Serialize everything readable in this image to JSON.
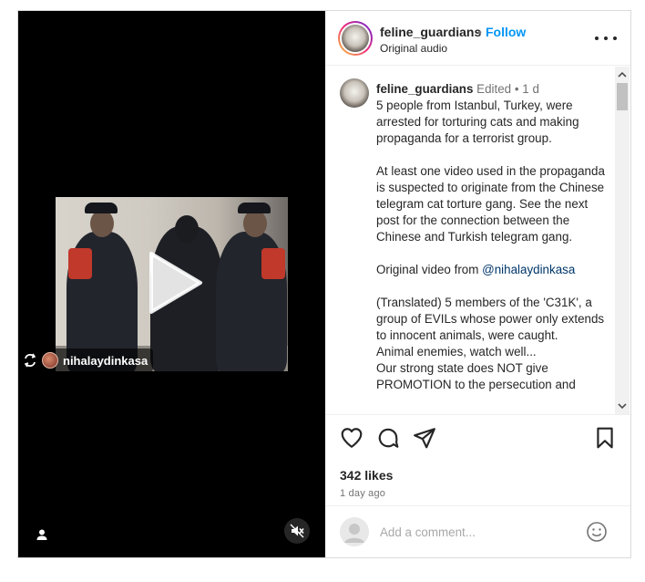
{
  "post": {
    "media": {
      "tag_username": "nihalaydinkasa",
      "icons": {
        "play": "play-icon",
        "tag_reel": "reel-share-icon",
        "user_tags": "user-tag-icon",
        "mute": "mute-icon"
      }
    },
    "header": {
      "username": "feline_guardians",
      "separator": "•",
      "follow_label": "Follow",
      "audio": "Original audio",
      "more_icon": "more-horizontal-icon"
    },
    "caption": {
      "username": "feline_guardians",
      "edited": "Edited",
      "separator": "•",
      "age": "1 d",
      "body_part1": "5 people from Istanbul, Turkey, were arrested for torturing cats and making propaganda for a terrorist group.\n\nAt least one video used in the propaganda is suspected to originate from the Chinese telegram cat torture gang. See the next post for the connection between the Chinese and Turkish telegram gang.\n\nOriginal video from ",
      "mention": "@nihalaydinkasa",
      "body_part2": "\n\n(Translated) 5 members of the 'C31K', a group of EVILs whose power only extends to innocent animals, were caught.\nAnimal enemies, watch well...\nOur strong state does NOT give PROMOTION to the persecution and"
    },
    "actions": {
      "like_icon": "heart-icon",
      "comment_icon": "comment-icon",
      "share_icon": "send-icon",
      "save_icon": "bookmark-icon",
      "likes": "342 likes",
      "time": "1 day ago"
    },
    "comment": {
      "placeholder": "Add a comment...",
      "emoji_icon": "emoji-icon"
    },
    "colors": {
      "accent": "#0095f6",
      "link": "#00376b",
      "muted": "#737373"
    }
  }
}
